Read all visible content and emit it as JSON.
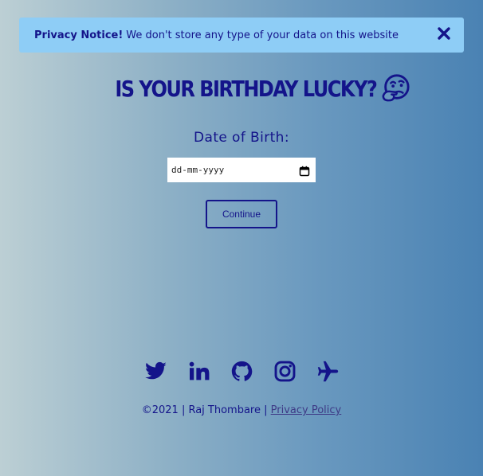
{
  "notice": {
    "bold": "Privacy Notice!",
    "text": "We don't store any type of your data on this website"
  },
  "title": "IS YOUR BIRTHDAY LUCKY?",
  "form": {
    "dob_label": "Date of Birth:",
    "date_placeholder": "dd-mm-yyyy",
    "continue_label": "Continue"
  },
  "socials": [
    "twitter-icon",
    "linkedin-icon",
    "github-icon",
    "instagram-icon",
    "airplane-icon"
  ],
  "footer": {
    "copyright": "©2021 | Raj Thombare |",
    "privacy_link": "Privacy Policy"
  },
  "colors": {
    "primary": "#14148a",
    "notice_bg": "#8ecdf6",
    "gradient_start": "#bccfd4",
    "gradient_end": "#4a82b3"
  }
}
